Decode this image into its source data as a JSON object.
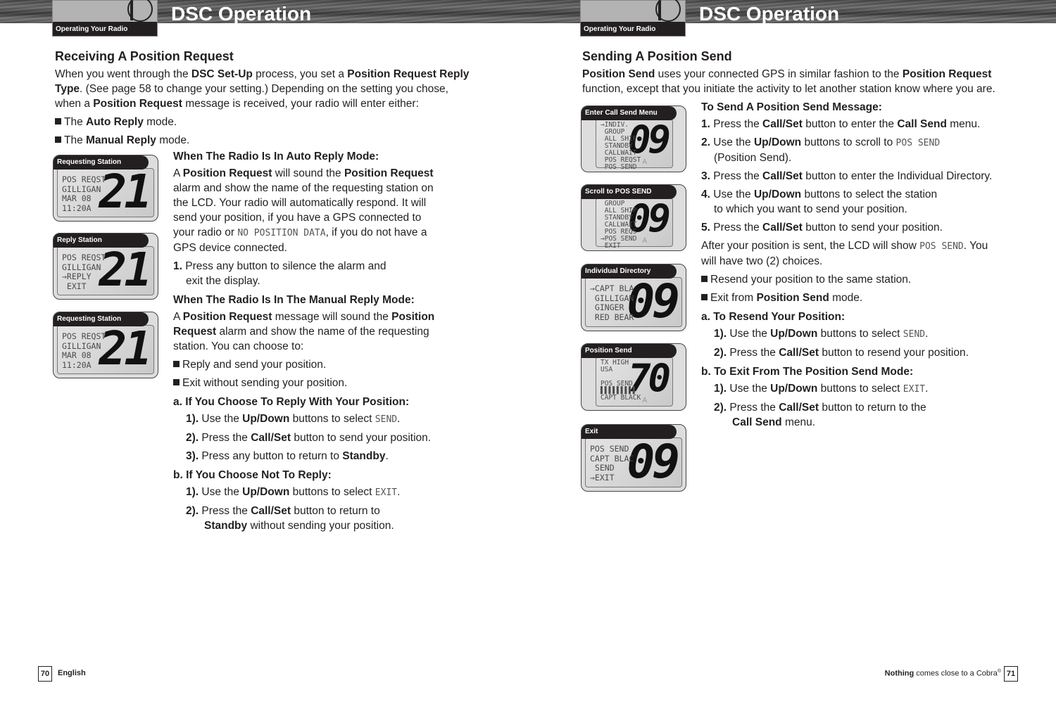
{
  "left_page": {
    "section_tab": "Operating Your Radio",
    "title": "DSC Operation",
    "heading": "Receiving A Position Request",
    "intro": [
      "When you went through the ",
      "DSC Set-Up",
      " process, you set a ",
      "Position Request Reply Type",
      ". (See page 58 to change your setting.) Depending on the setting you chose, when a ",
      "Position Request",
      " message is received, your radio will enter either:"
    ],
    "modes": [
      {
        "pre": "The ",
        "bold": "Auto Reply",
        "post": " mode."
      },
      {
        "pre": "The ",
        "bold": "Manual Reply",
        "post": " mode."
      }
    ],
    "auto": {
      "heading": "When The Radio Is In Auto Reply Mode:",
      "p": [
        "A ",
        "Position Request",
        " will sound the ",
        "Position Request",
        " alarm and show the name of the requesting station on the LCD. Your radio will automatically respond. It will send your position, if you have a GPS connected to your radio or ",
        "NO POSITION DATA",
        ", if you do not have a GPS device connected."
      ],
      "step1_num": "1.",
      "step1": "Press any button to silence the alarm and exit the display."
    },
    "manual": {
      "heading": "When The Radio Is In The Manual Reply Mode:",
      "p": [
        "A ",
        "Position Request",
        " message will sound the ",
        "Position Request",
        " alarm and show the name of the requesting station. You can choose to:"
      ],
      "choices": [
        "Reply and send your position.",
        "Exit without sending your position."
      ]
    },
    "a": {
      "heading": "a. If You Choose To Reply With Your Position:",
      "steps": [
        {
          "num": "1).",
          "parts": [
            "Use the ",
            "Up/Down",
            " buttons to select ",
            "SEND",
            "."
          ]
        },
        {
          "num": "2).",
          "parts": [
            "Press the ",
            "Call/Set",
            " button to send your position."
          ]
        },
        {
          "num": "3).",
          "parts": [
            "Press any button to return to ",
            "Standby",
            "."
          ]
        }
      ]
    },
    "b": {
      "heading": "b. If You Choose Not To Reply:",
      "steps": [
        {
          "num": "1).",
          "parts": [
            "Use the ",
            "Up/Down",
            " buttons to select ",
            "EXIT",
            "."
          ]
        },
        {
          "num": "2).",
          "parts": [
            "Press the ",
            "Call/Set",
            " button to return to ",
            "Standby",
            " without sending your position."
          ]
        }
      ]
    },
    "radios": [
      {
        "label": "Requesting Station",
        "lines": "POS REQST\nGILLIGAN\nMAR 08\n11:20A",
        "channel": "21"
      },
      {
        "label": "Reply Station",
        "lines": "POS REQST\nGILLIGAN\n→REPLY\n EXIT",
        "channel": "21"
      },
      {
        "label": "Requesting Station",
        "lines": "POS REQST\nGILLIGAN\nMAR 08\n11:20A",
        "channel": "21"
      }
    ],
    "footer_page": "70",
    "footer_text": "English"
  },
  "right_page": {
    "section_tab": "Operating Your Radio",
    "title": "DSC Operation",
    "heading": "Sending A Position Send",
    "intro": [
      "Position Send",
      " uses your connected GPS in similar fashion to the ",
      "Position Request",
      " function, except that you initiate the activity to let another station know where you are."
    ],
    "send": {
      "heading": "To Send A Position Send Message:",
      "steps": [
        {
          "num": "1.",
          "parts": [
            "Press the ",
            "Call/Set",
            " button to enter the ",
            "Call Send",
            " menu."
          ]
        },
        {
          "num": "2.",
          "parts": [
            "Use the ",
            "Up/Down",
            " buttons to scroll to ",
            "POS SEND",
            " (Position Send)."
          ]
        },
        {
          "num": "3.",
          "parts": [
            "Press the ",
            "Call/Set",
            " button to enter the Individual Directory."
          ]
        },
        {
          "num": "4.",
          "parts": [
            "Use the ",
            "Up/Down",
            " buttons to select the station to which you want to send your position."
          ]
        },
        {
          "num": "5.",
          "parts": [
            "Press the ",
            "Call/Set",
            " button to send your position."
          ]
        }
      ]
    },
    "after": [
      "After your position is sent, the LCD will show ",
      "POS SEND",
      ". You will have two (2) choices."
    ],
    "choices": [
      {
        "pre": "Resend your position to the same station.",
        "bold": "",
        "post": ""
      },
      {
        "pre": "Exit from ",
        "bold": "Position Send",
        "post": " mode."
      }
    ],
    "a": {
      "heading": "a. To Resend Your Position:",
      "steps": [
        {
          "num": "1).",
          "parts": [
            "Use the ",
            "Up/Down",
            " buttons to select ",
            "SEND",
            "."
          ]
        },
        {
          "num": "2).",
          "parts": [
            "Press the ",
            "Call/Set",
            " button to resend your position."
          ]
        }
      ]
    },
    "b": {
      "heading": "b. To Exit From The Position Send Mode:",
      "steps": [
        {
          "num": "1).",
          "parts": [
            "Use the ",
            "Up/Down",
            " buttons to select ",
            "EXIT",
            "."
          ]
        },
        {
          "num": "2).",
          "parts": [
            "Press the ",
            "Call/Set",
            " button to return to the ",
            "Call Send",
            " menu."
          ]
        }
      ]
    },
    "radios": [
      {
        "label": "Enter Call Send Menu",
        "lines": "→INDIV.\n GROUP\n ALL SHIP\n STANDBY\n CALLWAIT\n POS REQST\n POS SEND",
        "channel": "09",
        "chan_letter": "A"
      },
      {
        "label": "Scroll to POS SEND",
        "lines": " GROUP\n ALL SHIP\n STANDBY\n CALLWAIT\n POS REQS\n→POS SEND\n EXIT",
        "channel": "09",
        "chan_letter": "A"
      },
      {
        "label": "Individual Directory",
        "lines": "→CAPT BLA\n GILLIGAN\n GINGER\n RED BEAR",
        "channel": "09"
      },
      {
        "label": "Position Send",
        "lines": "TX HIGH\nUSA\n\nPOS SEND\n▌▌▌▌▌▌▌▌▌\nCAPT BLACK",
        "channel": "70",
        "chan_letter": "A"
      },
      {
        "label": "Exit",
        "lines": "POS SEND\nCAPT BLAC\n SEND\n→EXIT",
        "channel": "09"
      }
    ],
    "footer_brand_bold": "Nothing",
    "footer_brand": " comes close to a Cobra",
    "footer_reg": "®",
    "footer_page": "71"
  }
}
